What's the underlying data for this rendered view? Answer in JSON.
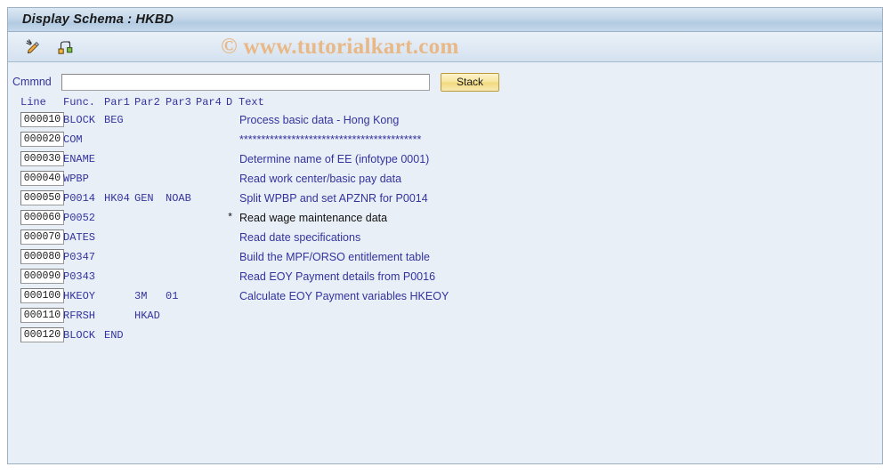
{
  "window": {
    "title": "Display Schema : HKBD"
  },
  "watermark": {
    "text": "© www.tutorialkart.com"
  },
  "toolbar": {
    "buttons": [
      {
        "name": "edit-pencil-icon",
        "tooltip": "Change"
      },
      {
        "name": "hierarchy-icon",
        "tooltip": "Structure"
      }
    ]
  },
  "command": {
    "label": "Cmmnd",
    "value": "",
    "placeholder": "",
    "stack_label": "Stack"
  },
  "table": {
    "headers": {
      "line": "Line",
      "func": "Func.",
      "par1": "Par1",
      "par2": "Par2",
      "par3": "Par3",
      "par4": "Par4",
      "d": "D",
      "text": "Text"
    },
    "rows": [
      {
        "line": "000010",
        "func": "BLOCK",
        "par1": "BEG",
        "par2": "",
        "par3": "",
        "par4": "",
        "d": "",
        "text": "Process basic data - Hong Kong",
        "inactive": false
      },
      {
        "line": "000020",
        "func": "COM",
        "par1": "",
        "par2": "",
        "par3": "",
        "par4": "",
        "d": "",
        "text": "******************************************",
        "inactive": false
      },
      {
        "line": "000030",
        "func": "ENAME",
        "par1": "",
        "par2": "",
        "par3": "",
        "par4": "",
        "d": "",
        "text": "Determine name of EE (infotype 0001)",
        "inactive": false
      },
      {
        "line": "000040",
        "func": "WPBP",
        "par1": "",
        "par2": "",
        "par3": "",
        "par4": "",
        "d": "",
        "text": "Read work center/basic pay data",
        "inactive": false
      },
      {
        "line": "000050",
        "func": "P0014",
        "par1": "HK04",
        "par2": "GEN",
        "par3": "NOAB",
        "par4": "",
        "d": "",
        "text": "Split WPBP and set APZNR for P0014",
        "inactive": false
      },
      {
        "line": "000060",
        "func": "P0052",
        "par1": "",
        "par2": "",
        "par3": "",
        "par4": "",
        "d": "*",
        "text": "Read wage maintenance data",
        "inactive": true
      },
      {
        "line": "000070",
        "func": "DATES",
        "par1": "",
        "par2": "",
        "par3": "",
        "par4": "",
        "d": "",
        "text": "Read date specifications",
        "inactive": false
      },
      {
        "line": "000080",
        "func": "P0347",
        "par1": "",
        "par2": "",
        "par3": "",
        "par4": "",
        "d": "",
        "text": "Build the MPF/ORSO entitlement table",
        "inactive": false
      },
      {
        "line": "000090",
        "func": "P0343",
        "par1": "",
        "par2": "",
        "par3": "",
        "par4": "",
        "d": "",
        "text": "Read EOY Payment details from P0016",
        "inactive": false
      },
      {
        "line": "000100",
        "func": "HKEOY",
        "par1": "",
        "par2": "3M",
        "par3": "01",
        "par4": "",
        "d": "",
        "text": "Calculate EOY Payment variables HKEOY",
        "inactive": false
      },
      {
        "line": "000110",
        "func": "RFRSH",
        "par1": "",
        "par2": "HKAD",
        "par3": "",
        "par4": "",
        "d": "",
        "text": "",
        "inactive": false
      },
      {
        "line": "000120",
        "func": "BLOCK",
        "par1": "END",
        "par2": "",
        "par3": "",
        "par4": "",
        "d": "",
        "text": "",
        "inactive": false
      }
    ]
  },
  "colors": {
    "field_text": "#33339e",
    "inactive_text": "#111111",
    "title_bar": "#c6d8e9",
    "watermark": "#e8b887",
    "button_accent": "#f2d97c"
  }
}
